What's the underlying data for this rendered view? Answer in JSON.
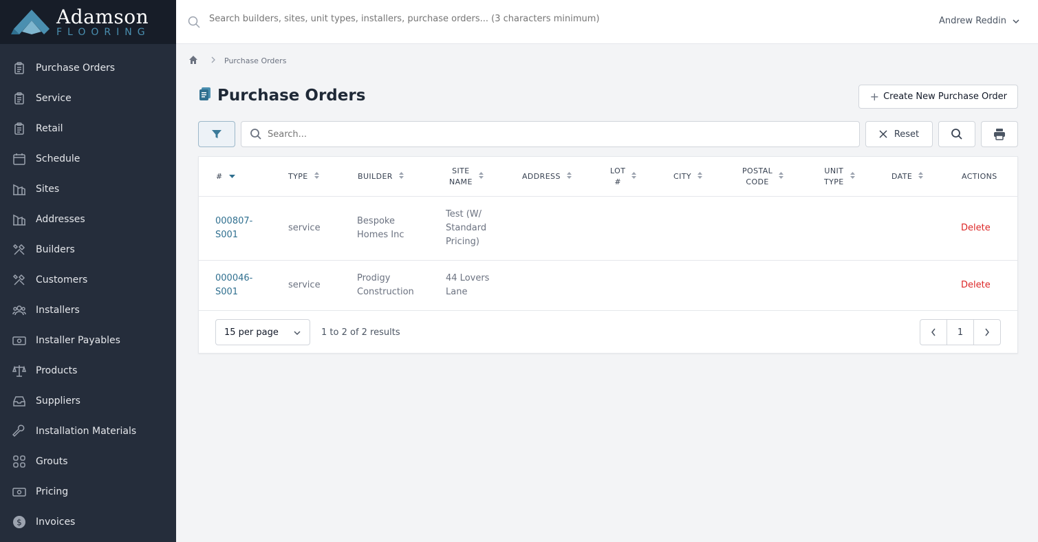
{
  "brand": {
    "name": "Adamson",
    "sub": "FLOORING"
  },
  "sidebar": {
    "items": [
      {
        "label": "Purchase Orders",
        "icon": "clipboard-icon"
      },
      {
        "label": "Service",
        "icon": "clipboard-icon"
      },
      {
        "label": "Retail",
        "icon": "clipboard-icon"
      },
      {
        "label": "Schedule",
        "icon": "calendar-icon"
      },
      {
        "label": "Sites",
        "icon": "building-icon"
      },
      {
        "label": "Addresses",
        "icon": "building-icon"
      },
      {
        "label": "Builders",
        "icon": "tools-icon"
      },
      {
        "label": "Customers",
        "icon": "tools-icon"
      },
      {
        "label": "Installers",
        "icon": "users-icon"
      },
      {
        "label": "Installer Payables",
        "icon": "cash-icon"
      },
      {
        "label": "Products",
        "icon": "scale-icon"
      },
      {
        "label": "Suppliers",
        "icon": "inbox-icon"
      },
      {
        "label": "Installation Materials",
        "icon": "wrench-icon"
      },
      {
        "label": "Grouts",
        "icon": "grid-icon"
      },
      {
        "label": "Pricing",
        "icon": "cash-icon"
      },
      {
        "label": "Invoices",
        "icon": "dollar-icon"
      }
    ]
  },
  "topbar": {
    "search_placeholder": "Search builders, sites, unit types, installers, purchase orders... (3 characters minimum)",
    "user_name": "Andrew Reddin"
  },
  "breadcrumb": {
    "current": "Purchase Orders"
  },
  "page": {
    "title": "Purchase Orders",
    "create_label": "Create New Purchase Order"
  },
  "toolbar": {
    "search_placeholder": "Search...",
    "reset_label": "Reset"
  },
  "table": {
    "columns": [
      {
        "key": "number",
        "label": "#"
      },
      {
        "key": "type",
        "label": "TYPE"
      },
      {
        "key": "builder",
        "label": "BUILDER"
      },
      {
        "key": "site_name",
        "label": "SITE\nNAME"
      },
      {
        "key": "address",
        "label": "ADDRESS"
      },
      {
        "key": "lot",
        "label": "LOT\n#"
      },
      {
        "key": "city",
        "label": "CITY"
      },
      {
        "key": "postal_code",
        "label": "POSTAL\nCODE"
      },
      {
        "key": "unit_type",
        "label": "UNIT\nTYPE"
      },
      {
        "key": "date",
        "label": "DATE"
      },
      {
        "key": "actions",
        "label": "ACTIONS"
      }
    ],
    "rows": [
      {
        "number": "000807-\nS001",
        "type": "service",
        "builder": "Bespoke\nHomes Inc",
        "site_name": "Test (W/\nStandard\nPricing)",
        "address": "",
        "lot": "",
        "city": "",
        "postal_code": "",
        "unit_type": "",
        "date": "",
        "action": "Delete"
      },
      {
        "number": "000046-\nS001",
        "type": "service",
        "builder": "Prodigy\nConstruction",
        "site_name": "44 Lovers\nLane",
        "address": "",
        "lot": "",
        "city": "",
        "postal_code": "",
        "unit_type": "",
        "date": "",
        "action": "Delete"
      }
    ]
  },
  "footer": {
    "per_page": "15 per page",
    "results": "1 to 2 of 2 results",
    "current_page": "1"
  },
  "colors": {
    "sidebar_bg": "#252d3b",
    "logo_bg": "#171d28",
    "accent": "#2f6f8f",
    "danger": "#dc2626"
  }
}
